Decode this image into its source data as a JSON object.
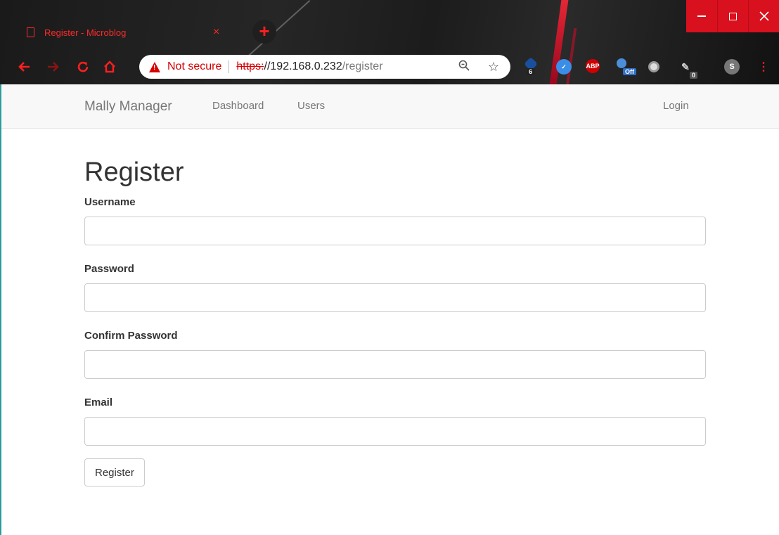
{
  "browser": {
    "tab_title": "Register - Microblog",
    "tab_close": "×",
    "new_tab": "+",
    "address": {
      "warning_label": "Not secure",
      "scheme": "https:",
      "host": "//192.168.0.232",
      "path": "/register"
    },
    "extensions": {
      "badge_1": "6",
      "abp_label": "ABP",
      "off_label": "Off",
      "badge_2": "0",
      "profile_initial": "S"
    }
  },
  "navbar": {
    "brand": "Mally Manager",
    "links": [
      "Dashboard",
      "Users"
    ],
    "login": "Login"
  },
  "form": {
    "heading": "Register",
    "fields": [
      {
        "label": "Username",
        "value": ""
      },
      {
        "label": "Password",
        "value": ""
      },
      {
        "label": "Confirm Password",
        "value": ""
      },
      {
        "label": "Email",
        "value": ""
      }
    ],
    "submit_label": "Register"
  }
}
